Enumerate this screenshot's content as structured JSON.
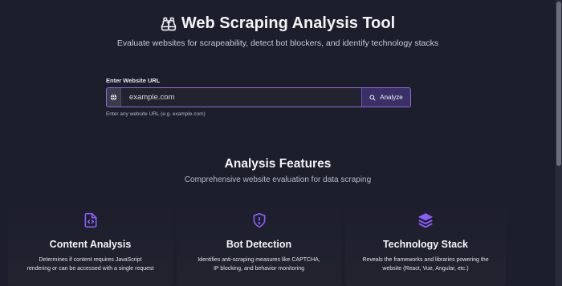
{
  "hero": {
    "title": "Web Scraping Analysis Tool",
    "subtitle": "Evaluate websites for scrapeability, detect bot blockers, and identify technology stacks"
  },
  "url_form": {
    "label": "Enter Website URL",
    "placeholder": "example.com",
    "button_label": "Analyze",
    "hint": "Enter any website URL (e.g. example.com)"
  },
  "features_section": {
    "title": "Analysis Features",
    "subtitle": "Comprehensive website evaluation for data scraping",
    "cards": [
      {
        "icon": "code-file-icon",
        "title": "Content Analysis",
        "desc_line1": "Determines if content requires JavaScript",
        "desc_line2": "rendering or can be accessed with a single request"
      },
      {
        "icon": "shield-icon",
        "title": "Bot Detection",
        "desc_line1": "Identifies anti-scraping measures like CAPTCHA,",
        "desc_line2": "IP blocking, and behavior monitoring"
      },
      {
        "icon": "layers-icon",
        "title": "Technology Stack",
        "desc_line1": "Reveals the frameworks and libraries powering the",
        "desc_line2": "website (React, Vue, Angular, etc.)"
      }
    ]
  },
  "colors": {
    "background": "#1d1e2c",
    "accent": "#8b5cf6",
    "button_bg": "#3a2f66"
  }
}
